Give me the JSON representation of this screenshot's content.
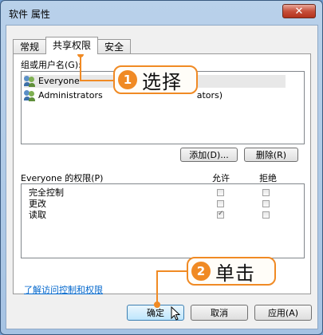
{
  "window": {
    "title": "软件 属性",
    "close_glyph": "✕"
  },
  "tabs": [
    {
      "label": "常规",
      "active": false
    },
    {
      "label": "共享权限",
      "active": true
    },
    {
      "label": "安全",
      "active": false
    }
  ],
  "groups": {
    "label": "组或用户名(G):",
    "items": [
      {
        "name": "Everyone",
        "icon": "users-icon",
        "selected": true
      },
      {
        "name": "Administrators",
        "suffix": "ators)",
        "icon": "users-icon",
        "selected": false
      }
    ]
  },
  "group_buttons": {
    "add": "添加(D)...",
    "remove": "删除(R)"
  },
  "permissions": {
    "label": "Everyone 的权限(P)",
    "allow_header": "允许",
    "deny_header": "拒绝",
    "rows": [
      {
        "name": "完全控制",
        "allow": false,
        "deny": false
      },
      {
        "name": "更改",
        "allow": false,
        "deny": false
      },
      {
        "name": "读取",
        "allow": true,
        "deny": false
      }
    ]
  },
  "link": "了解访问控制和权限",
  "footer_buttons": {
    "ok": "确定",
    "cancel": "取消",
    "apply": "应用(A)"
  },
  "annotations": {
    "step1": {
      "number": "1",
      "text": "选择"
    },
    "step2": {
      "number": "2",
      "text": "单击"
    }
  },
  "colors": {
    "accent": "#f08a24",
    "link": "#0066cc",
    "close": "#c7503b"
  }
}
